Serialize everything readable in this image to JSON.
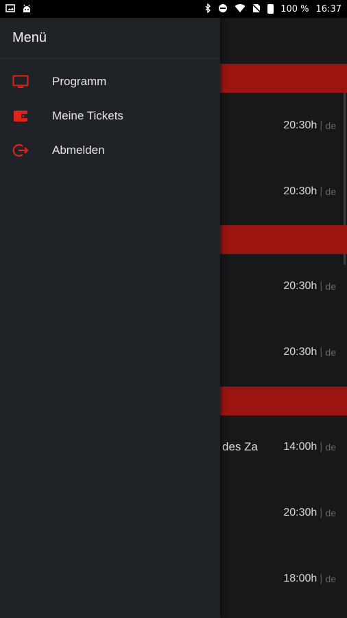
{
  "status_bar": {
    "battery": "100 %",
    "time": "16:37",
    "icons": [
      "image-icon",
      "android-icon",
      "bluetooth-icon",
      "dnd-icon",
      "wifi-icon",
      "no-sim-icon",
      "battery-icon"
    ]
  },
  "drawer": {
    "title": "Menü",
    "items": [
      {
        "label": "Programm",
        "icon": "tv-icon"
      },
      {
        "label": "Meine Tickets",
        "icon": "wallet-icon"
      },
      {
        "label": "Abmelden",
        "icon": "logout-icon"
      }
    ],
    "accent": "#e0231b"
  },
  "list": {
    "band_color": "#9a1510",
    "rows": [
      {
        "time": "20:30h",
        "sep": "|",
        "lang": "de"
      },
      {
        "time": "20:30h",
        "sep": "|",
        "lang": "de"
      },
      {
        "time": "20:30h",
        "sep": "|",
        "lang": "de"
      },
      {
        "time": "20:30h",
        "sep": "|",
        "lang": "de"
      },
      {
        "title_fragment": "des Za",
        "time": "14:00h",
        "sep": "|",
        "lang": "de"
      },
      {
        "time": "20:30h",
        "sep": "|",
        "lang": "de"
      },
      {
        "time": "18:00h",
        "sep": "|",
        "lang": "de"
      }
    ]
  }
}
